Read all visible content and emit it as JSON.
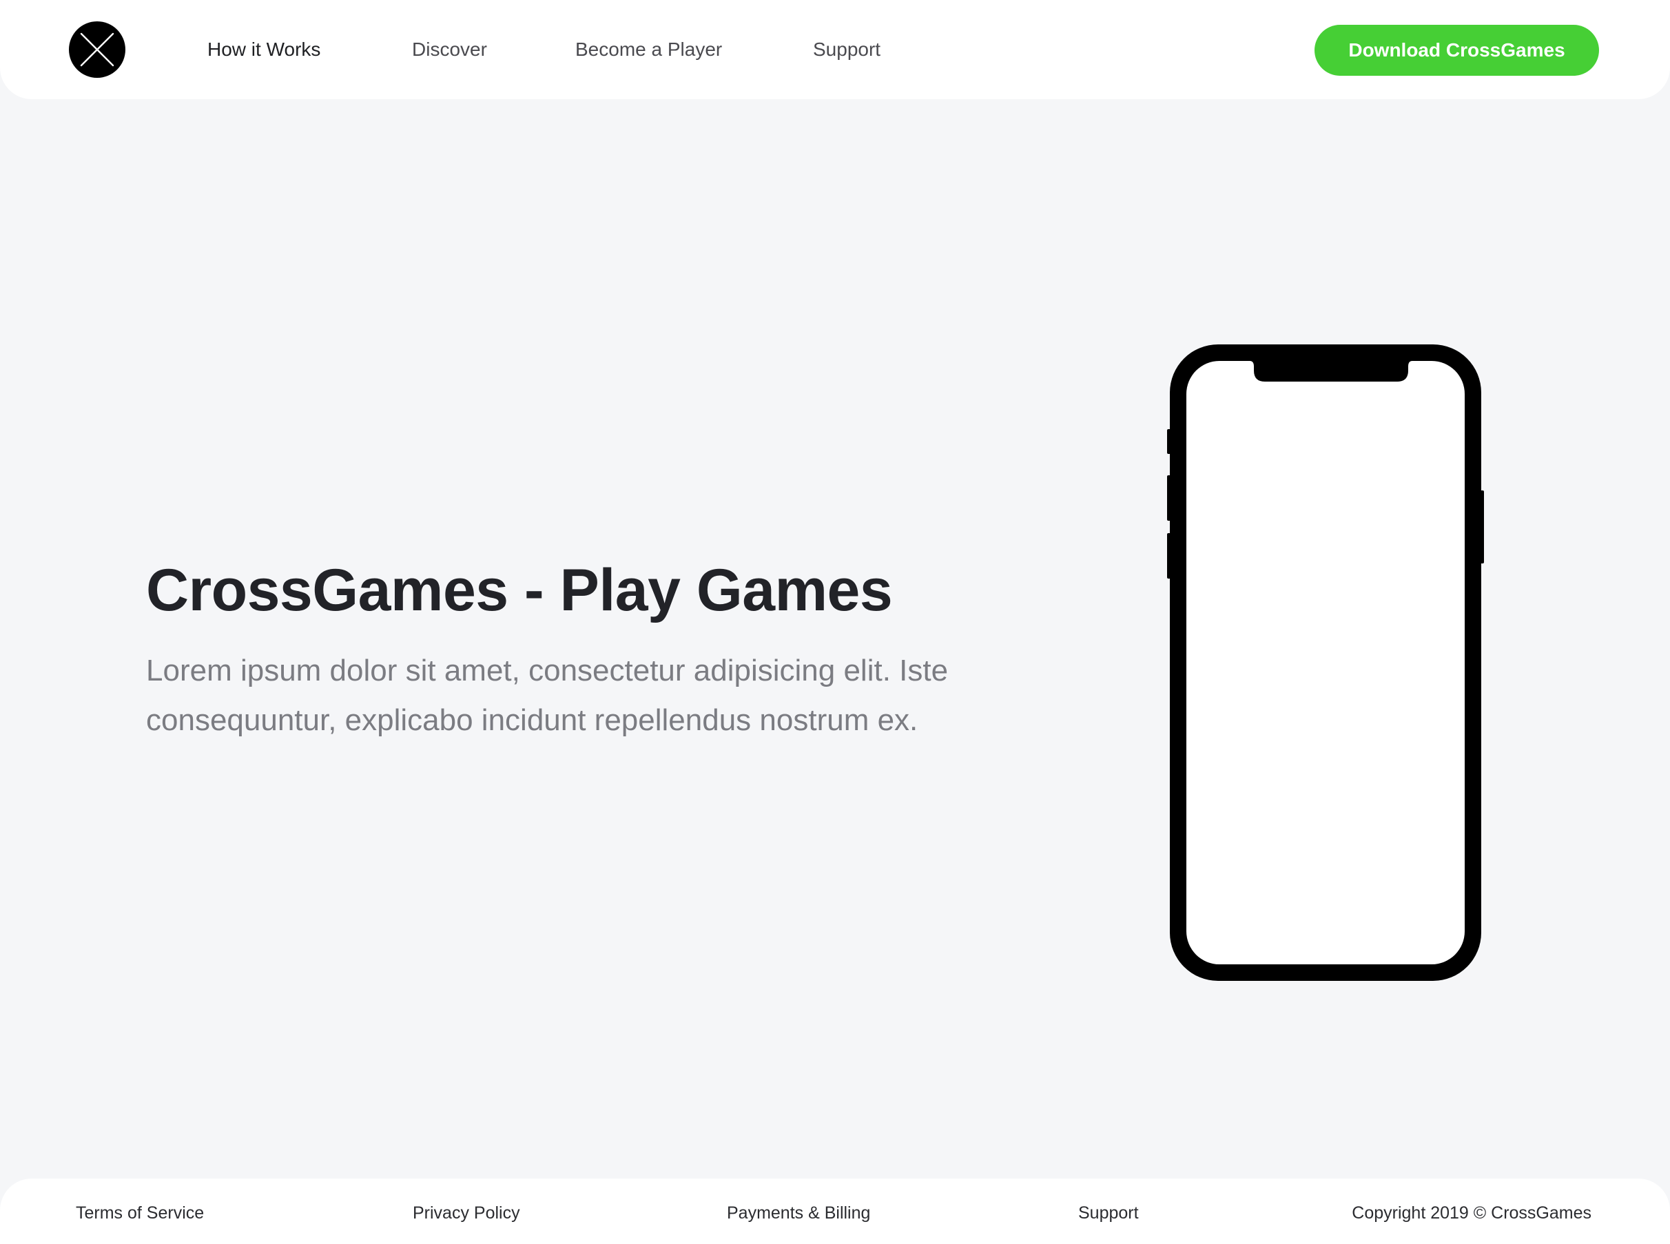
{
  "header": {
    "logo_icon": "crossed-x-circle-icon",
    "nav": [
      {
        "label": "How it Works"
      },
      {
        "label": "Discover"
      },
      {
        "label": "Become a Player"
      },
      {
        "label": "Support"
      }
    ],
    "cta_label": "Download CrossGames"
  },
  "hero": {
    "title": "CrossGames - Play Games",
    "description": "Lorem ipsum dolor sit amet, consectetur adipisicing elit. Iste consequuntur, explicabo incidunt repellendus nostrum ex.",
    "device_icon": "smartphone-mockup-icon"
  },
  "footer": {
    "links": [
      {
        "label": "Terms of Service"
      },
      {
        "label": "Privacy Policy"
      },
      {
        "label": "Payments & Billing"
      },
      {
        "label": "Support"
      }
    ],
    "copyright": "Copyright 2019 © CrossGames"
  },
  "colors": {
    "accent": "#46cf35",
    "background": "#f5f6f8",
    "surface": "#ffffff",
    "heading": "#222328",
    "body_text": "#7b7c82"
  }
}
